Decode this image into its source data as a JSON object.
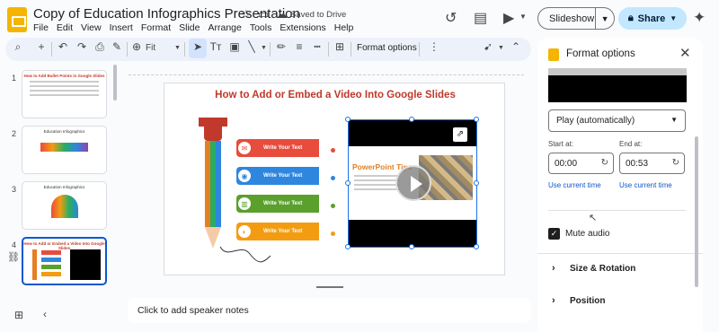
{
  "header": {
    "title": "Copy of Education Infographics Presentation",
    "saved_status": "Saved to Drive",
    "menu": [
      "File",
      "Edit",
      "View",
      "Insert",
      "Format",
      "Slide",
      "Arrange",
      "Tools",
      "Extensions",
      "Help"
    ],
    "slideshow_label": "Slideshow",
    "share_label": "Share"
  },
  "toolbar": {
    "zoom_label": "Fit",
    "format_options_label": "Format options"
  },
  "filmstrip": {
    "slides": [
      {
        "number": "1",
        "title": "How to Add Bullet Points in Google Slides"
      },
      {
        "number": "2",
        "title": "Education Infographics"
      },
      {
        "number": "3",
        "title": "Education Infographics"
      },
      {
        "number": "4",
        "title": "How to Add or Embed a Video Into Google Slides"
      }
    ]
  },
  "slide": {
    "title": "How to Add or Embed a Video Into Google Slides",
    "items": [
      "Write Your Text",
      "Write Your Text",
      "Write Your Text",
      "Write Your Text"
    ],
    "item_colors": [
      "#e74c3c",
      "#2e86de",
      "#5aa02c",
      "#f39c12"
    ],
    "video_caption": "PowerPoint Tips"
  },
  "notes": {
    "placeholder": "Click to add speaker notes"
  },
  "panel": {
    "title": "Format options",
    "playback": "Play (automatically)",
    "start_label": "Start at:",
    "end_label": "End at:",
    "start_value": "00:00",
    "end_value": "00:53",
    "use_current_time": "Use current time",
    "mute_label": "Mute audio",
    "mute_checked": true,
    "sections": [
      "Size & Rotation",
      "Position"
    ]
  }
}
